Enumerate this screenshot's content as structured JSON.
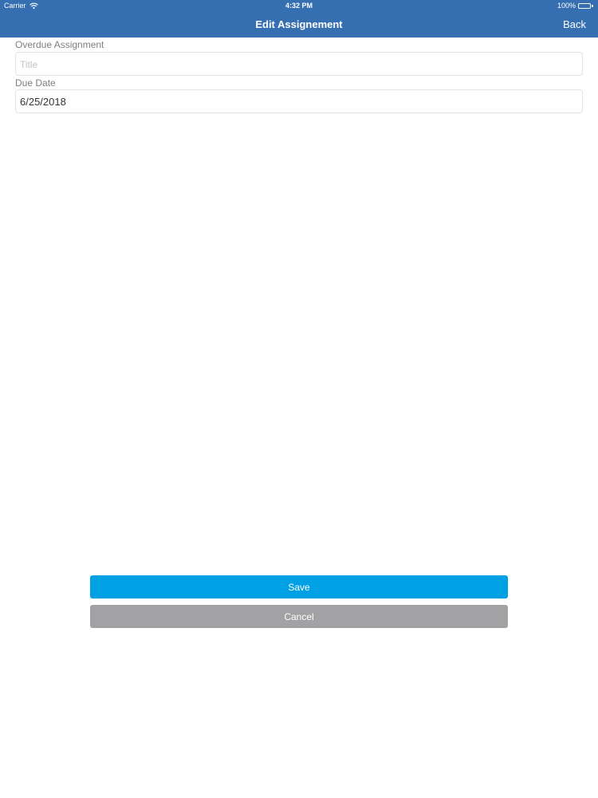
{
  "status_bar": {
    "carrier": "Carrier",
    "time": "4:32 PM",
    "battery": "100%"
  },
  "nav": {
    "title": "Edit Assignement",
    "back_label": "Back"
  },
  "form": {
    "title_label": "Overdue Assignment",
    "title_value": "",
    "title_placeholder": "Title",
    "due_label": "Due Date",
    "due_value": "6/25/2018"
  },
  "actions": {
    "save_label": "Save",
    "cancel_label": "Cancel"
  },
  "colors": {
    "nav_bar": "#356fb1",
    "save_button": "#00a0e5",
    "cancel_button": "#a2a2a4"
  },
  "icons": [
    "wifi-icon",
    "battery-icon"
  ]
}
